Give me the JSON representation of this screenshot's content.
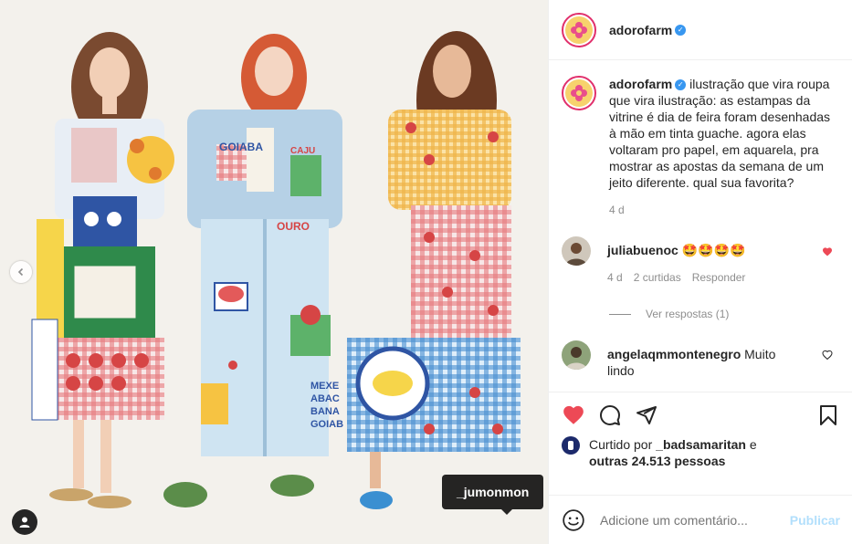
{
  "post": {
    "username": "adorofarm",
    "caption": "ilustração que vira roupa que vira ilustração: as estampas da vitrine é dia de feira foram desenhadas à mão em tinta guache. agora elas voltaram pro papel, em aquarela, pra mostrar as apostas da semana de um jeito diferente. qual sua favorita?",
    "caption_time": "4 d"
  },
  "image": {
    "tag_label": "_jumonmon",
    "illustration_texts": [
      "GOIABA",
      "CAJU",
      "OURO",
      "MEXE",
      "ABAC",
      "BANA",
      "GOIAB"
    ]
  },
  "comments": [
    {
      "username": "juliabuenoc",
      "text": "🤩🤩🤩🤩",
      "time": "4 d",
      "likes": "2 curtidas",
      "reply": "Responder",
      "view_replies": "Ver respostas (1)"
    },
    {
      "username": "angelaqmmontenegro",
      "text": "Muito lindo"
    }
  ],
  "likes": {
    "prefix": "Curtido por",
    "user": "_badsamaritan",
    "conj": "e",
    "others": "outras 24.513 pessoas"
  },
  "add_comment": {
    "placeholder": "Adicione um comentário...",
    "publish": "Publicar"
  },
  "colors": {
    "like_red": "#ed4956",
    "verified_blue": "#3897f0",
    "muted": "#8e8e8e",
    "publish_disabled": "#b2dffc"
  },
  "icons": [
    "chevron-left-icon",
    "user-tag-icon",
    "verified-icon",
    "heart-icon",
    "comment-icon",
    "share-icon",
    "bookmark-icon",
    "emoji-icon"
  ]
}
